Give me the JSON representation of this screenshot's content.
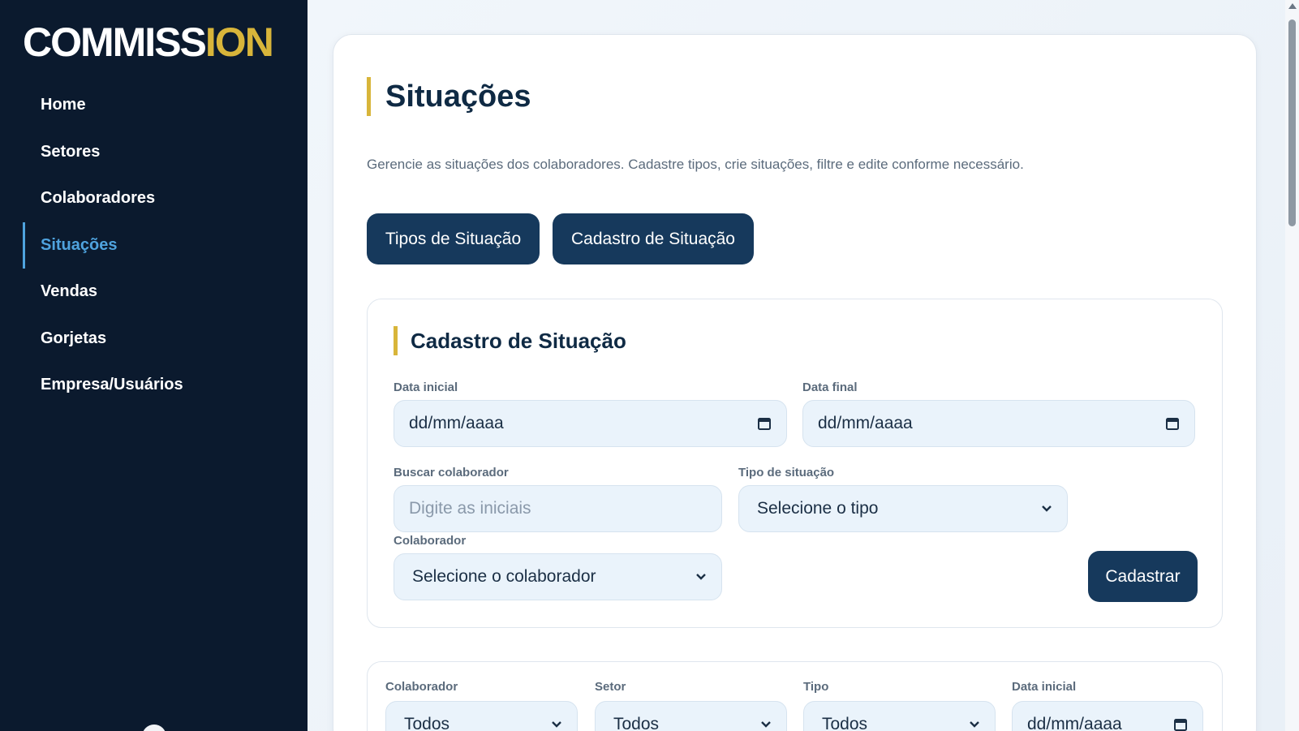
{
  "brand": {
    "logo_main": "COMMISS",
    "logo_accent": "ION"
  },
  "sidebar": {
    "items": [
      {
        "label": "Home"
      },
      {
        "label": "Setores"
      },
      {
        "label": "Colaboradores"
      },
      {
        "label": "Situações",
        "active": true
      },
      {
        "label": "Vendas"
      },
      {
        "label": "Gorjetas"
      },
      {
        "label": "Empresa/Usuários"
      }
    ]
  },
  "page": {
    "title": "Situações",
    "description": "Gerencie as situações dos colaboradores. Cadastre tipos, crie situações, filtre e edite conforme necessário.",
    "tabs": [
      {
        "label": "Tipos de Situação"
      },
      {
        "label": "Cadastro de Situação"
      }
    ]
  },
  "form": {
    "title": "Cadastro de Situação",
    "date_start": {
      "label": "Data inicial",
      "value": "dd/mm/aaaa"
    },
    "date_end": {
      "label": "Data final",
      "value": "dd/mm/aaaa"
    },
    "search": {
      "label": "Buscar colaborador",
      "placeholder": "Digite as iniciais"
    },
    "type": {
      "label": "Tipo de situação",
      "value": "Selecione o tipo"
    },
    "employee": {
      "label": "Colaborador",
      "value": "Selecione o colaborador"
    },
    "submit_label": "Cadastrar"
  },
  "filters": {
    "employee": {
      "label": "Colaborador",
      "value": "Todos"
    },
    "sector": {
      "label": "Setor",
      "value": "Todos"
    },
    "type": {
      "label": "Tipo",
      "value": "Todos"
    },
    "date_start": {
      "label": "Data inicial",
      "value": "dd/mm/aaaa"
    }
  },
  "colors": {
    "sidebar_bg": "#0b1a2e",
    "accent_gold": "#d8b53a",
    "active_blue": "#4fa3de",
    "button_navy": "#16395c",
    "field_bg": "#eaf3fb"
  },
  "icons": {
    "calendar": "calendar-icon",
    "chevron": "chevron-down-icon"
  }
}
